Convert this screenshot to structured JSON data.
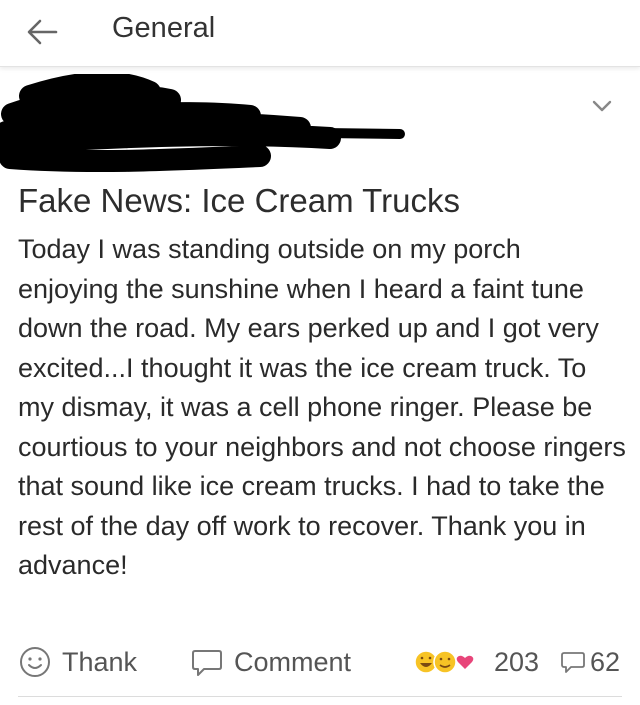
{
  "header": {
    "title": "General",
    "back_icon": "arrow-left-icon"
  },
  "post": {
    "title": "Fake News: Ice Cream Trucks",
    "body": "Today I was standing outside on my porch enjoying the sunshine when I heard a faint tune down the road. My ears perked up and I got very excited...I thought it was the ice cream truck. To my dismay, it was a cell phone ringer. Please be courtious to your neighbors and not choose ringers that sound like ice cream trucks. I had to take the rest of the day off work to recover. Thank you in advance!",
    "menu_icon": "chevron-down-icon"
  },
  "actions": {
    "thank_label": "Thank",
    "comment_label": "Comment",
    "reaction_count": "203",
    "comment_count": "62"
  },
  "colors": {
    "text": "#2a2a2a",
    "muted": "#555555",
    "reaction_yellow": "#f7c325",
    "reaction_pink": "#e8457a"
  }
}
